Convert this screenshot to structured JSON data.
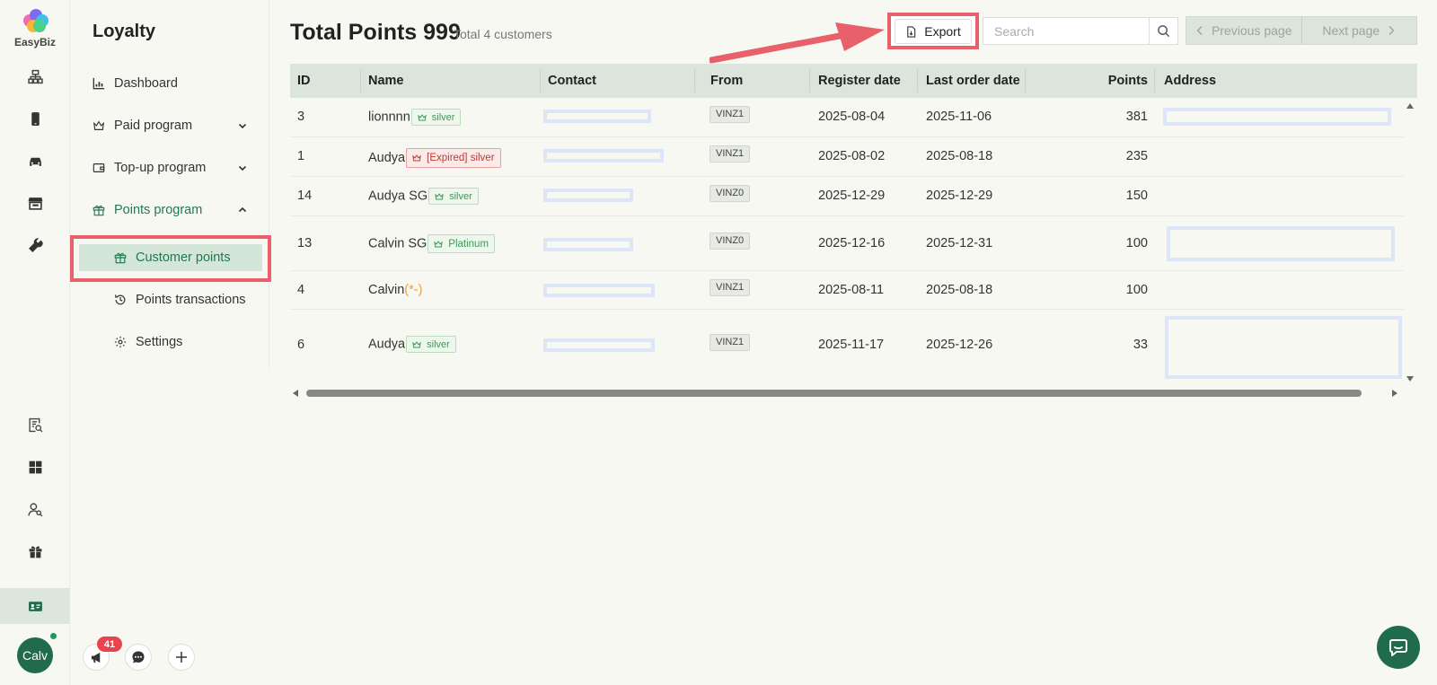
{
  "app": {
    "logo_text": "EasyBiz",
    "brand_color": "#1f6b4b",
    "accent_highlight": "#e8606a"
  },
  "rail": {
    "icons": [
      "org-chart-icon",
      "phone-icon",
      "car-icon",
      "store-icon",
      "wrench-icon",
      "report-search-icon",
      "dashboard-grid-icon",
      "people-search-icon",
      "gift-icon",
      "id-card-icon"
    ],
    "avatar_label": "Calv",
    "notification_count": "41"
  },
  "nav": {
    "title": "Loyalty",
    "items": [
      {
        "label": "Dashboard",
        "icon": "chart-icon"
      },
      {
        "label": "Paid program",
        "icon": "crown-icon"
      },
      {
        "label": "Top-up program",
        "icon": "wallet-icon"
      },
      {
        "label": "Points program",
        "icon": "gift-icon"
      },
      {
        "label": "Customer points",
        "icon": "gift-icon"
      },
      {
        "label": "Points transactions",
        "icon": "history-icon"
      },
      {
        "label": "Settings",
        "icon": "gear-icon"
      }
    ]
  },
  "header": {
    "title": "Total Points 999",
    "subtitle": "Total 4 customers",
    "export_label": "Export",
    "search_placeholder": "Search",
    "prev_label": "Previous page",
    "next_label": "Next page"
  },
  "table": {
    "columns": [
      "ID",
      "Name",
      "Contact",
      "From",
      "Register date",
      "Last order date",
      "Points",
      "Address"
    ],
    "rows": [
      {
        "id": "3",
        "name": "lionnnn",
        "suffix": "",
        "tag": "silver",
        "tag_type": "green",
        "from": "VINZ1",
        "register": "2025-08-04",
        "last_order": "2025-11-06",
        "points": "381"
      },
      {
        "id": "1",
        "name": "Audya",
        "suffix": "",
        "tag": "[Expired] silver",
        "tag_type": "red",
        "from": "VINZ1",
        "register": "2025-08-02",
        "last_order": "2025-08-18",
        "points": "235"
      },
      {
        "id": "14",
        "name": "Audya SG",
        "suffix": "",
        "tag": "silver",
        "tag_type": "green",
        "from": "VINZ0",
        "register": "2025-12-29",
        "last_order": "2025-12-29",
        "points": "150"
      },
      {
        "id": "13",
        "name": "Calvin SG",
        "suffix": "",
        "tag": "Platinum",
        "tag_type": "green",
        "from": "VINZ0",
        "register": "2025-12-16",
        "last_order": "2025-12-31",
        "points": "100"
      },
      {
        "id": "4",
        "name": "Calvin",
        "suffix": "(*-)",
        "tag": "",
        "tag_type": "",
        "from": "VINZ1",
        "register": "2025-08-11",
        "last_order": "2025-08-18",
        "points": "100"
      },
      {
        "id": "6",
        "name": "Audya",
        "suffix": "",
        "tag": "silver",
        "tag_type": "green",
        "from": "VINZ1",
        "register": "2025-11-17",
        "last_order": "2025-12-26",
        "points": "33"
      }
    ]
  }
}
